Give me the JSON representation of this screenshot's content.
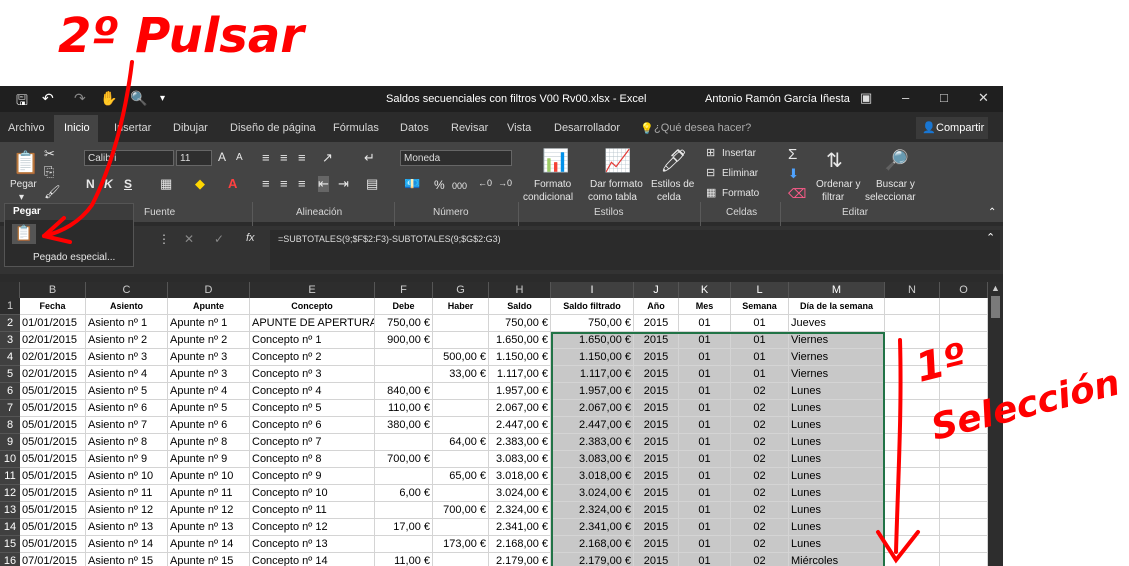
{
  "annotations": {
    "step2": "2º Pulsar",
    "step1_a": "1º",
    "step1_b": "Selección"
  },
  "window": {
    "title": "Saldos secuenciales con filtros V00 Rv00.xlsx  -  Excel",
    "user": "Antonio Ramón García Iñesta"
  },
  "menu": {
    "tabs": [
      "Archivo",
      "Inicio",
      "Insertar",
      "Dibujar",
      "Diseño de página",
      "Fórmulas",
      "Datos",
      "Revisar",
      "Vista",
      "Desarrollador"
    ],
    "tellme": "¿Qué desea hacer?",
    "share": "Compartir"
  },
  "ribbon": {
    "paste": "Pegar",
    "font_name": "Calibri",
    "font_size": "11",
    "bold": "N",
    "italic": "K",
    "underline": "S",
    "grow_font": "A",
    "shrink_font": "A",
    "number_format": "Moneda",
    "percent": "%",
    "thousands": "000",
    "format_cond": "Formato",
    "format_cond_2": "condicional",
    "format_table": "Dar formato",
    "format_table_2": "como tabla",
    "cell_styles": "Estilos de",
    "cell_styles_2": "celda",
    "insert": "Insertar",
    "delete": "Eliminar",
    "format": "Formato",
    "sort": "Ordenar y",
    "sort_2": "filtrar",
    "find": "Buscar y",
    "find_2": "seleccionar",
    "groups": {
      "clipboard": "Pegar",
      "font": "Fuente",
      "alignment": "Alineación",
      "number": "Número",
      "styles": "Estilos",
      "cells": "Celdas",
      "edit": "Editar"
    }
  },
  "paste_menu": {
    "title": "Pegar",
    "special": "Pegado especial..."
  },
  "formula": {
    "fx": "fx",
    "text": "=SUBTOTALES(9;$F$2:F3)-SUBTOTALES(9;$G$2:G3)"
  },
  "sheet": {
    "columns": [
      "B",
      "C",
      "D",
      "E",
      "F",
      "G",
      "H",
      "I",
      "J",
      "K",
      "L",
      "M",
      "N",
      "O"
    ],
    "rows": [
      [
        "1",
        "Fecha",
        "Asiento",
        "Apunte",
        "Concepto",
        "Debe",
        "Haber",
        "Saldo",
        "Saldo filtrado",
        "Año",
        "Mes",
        "Semana",
        "Día de la semana",
        "",
        ""
      ],
      [
        "2",
        "01/01/2015",
        "Asiento nº 1",
        "Apunte nº 1",
        "APUNTE DE APERTURA",
        "750,00 €",
        "",
        "750,00 €",
        "750,00 €",
        "2015",
        "01",
        "01",
        "Jueves",
        "",
        ""
      ],
      [
        "3",
        "02/01/2015",
        "Asiento nº 2",
        "Apunte nº 2",
        "Concepto nº 1",
        "900,00 €",
        "",
        "1.650,00 €",
        "1.650,00 €",
        "2015",
        "01",
        "01",
        "Viernes",
        "",
        ""
      ],
      [
        "4",
        "02/01/2015",
        "Asiento nº 3",
        "Apunte nº 3",
        "Concepto nº 2",
        "",
        "500,00 €",
        "1.150,00 €",
        "1.150,00 €",
        "2015",
        "01",
        "01",
        "Viernes",
        "",
        ""
      ],
      [
        "5",
        "02/01/2015",
        "Asiento nº 4",
        "Apunte nº 3",
        "Concepto nº 3",
        "",
        "33,00 €",
        "1.117,00 €",
        "1.117,00 €",
        "2015",
        "01",
        "01",
        "Viernes",
        "",
        ""
      ],
      [
        "6",
        "05/01/2015",
        "Asiento nº 5",
        "Apunte nº 4",
        "Concepto nº 4",
        "840,00 €",
        "",
        "1.957,00 €",
        "1.957,00 €",
        "2015",
        "01",
        "02",
        "Lunes",
        "",
        ""
      ],
      [
        "7",
        "05/01/2015",
        "Asiento nº 6",
        "Apunte nº 5",
        "Concepto nº 5",
        "110,00 €",
        "",
        "2.067,00 €",
        "2.067,00 €",
        "2015",
        "01",
        "02",
        "Lunes",
        "",
        ""
      ],
      [
        "8",
        "05/01/2015",
        "Asiento nº 7",
        "Apunte nº 6",
        "Concepto nº 6",
        "380,00 €",
        "",
        "2.447,00 €",
        "2.447,00 €",
        "2015",
        "01",
        "02",
        "Lunes",
        "",
        ""
      ],
      [
        "9",
        "05/01/2015",
        "Asiento nº 8",
        "Apunte nº 8",
        "Concepto nº 7",
        "",
        "64,00 €",
        "2.383,00 €",
        "2.383,00 €",
        "2015",
        "01",
        "02",
        "Lunes",
        "",
        ""
      ],
      [
        "10",
        "05/01/2015",
        "Asiento nº 9",
        "Apunte nº 9",
        "Concepto nº 8",
        "700,00 €",
        "",
        "3.083,00 €",
        "3.083,00 €",
        "2015",
        "01",
        "02",
        "Lunes",
        "",
        ""
      ],
      [
        "11",
        "05/01/2015",
        "Asiento nº 10",
        "Apunte nº 10",
        "Concepto nº 9",
        "",
        "65,00 €",
        "3.018,00 €",
        "3.018,00 €",
        "2015",
        "01",
        "02",
        "Lunes",
        "",
        ""
      ],
      [
        "12",
        "05/01/2015",
        "Asiento nº 11",
        "Apunte nº 11",
        "Concepto nº 10",
        "6,00 €",
        "",
        "3.024,00 €",
        "3.024,00 €",
        "2015",
        "01",
        "02",
        "Lunes",
        "",
        ""
      ],
      [
        "13",
        "05/01/2015",
        "Asiento nº 12",
        "Apunte nº 12",
        "Concepto nº 11",
        "",
        "700,00 €",
        "2.324,00 €",
        "2.324,00 €",
        "2015",
        "01",
        "02",
        "Lunes",
        "",
        ""
      ],
      [
        "14",
        "05/01/2015",
        "Asiento nº 13",
        "Apunte nº 13",
        "Concepto nº 12",
        "17,00 €",
        "",
        "2.341,00 €",
        "2.341,00 €",
        "2015",
        "01",
        "02",
        "Lunes",
        "",
        ""
      ],
      [
        "15",
        "05/01/2015",
        "Asiento nº 14",
        "Apunte nº 14",
        "Concepto nº 13",
        "",
        "173,00 €",
        "2.168,00 €",
        "2.168,00 €",
        "2015",
        "01",
        "02",
        "Lunes",
        "",
        ""
      ],
      [
        "16",
        "07/01/2015",
        "Asiento nº 15",
        "Apunte nº 15",
        "Concepto nº 14",
        "11,00 €",
        "",
        "2.179,00 €",
        "2.179,00 €",
        "2015",
        "01",
        "02",
        "Miércoles",
        "",
        ""
      ]
    ]
  },
  "colors": {
    "annotation": "#ff0000",
    "selection": "#c8c8c8",
    "selection_border": "#217346"
  }
}
